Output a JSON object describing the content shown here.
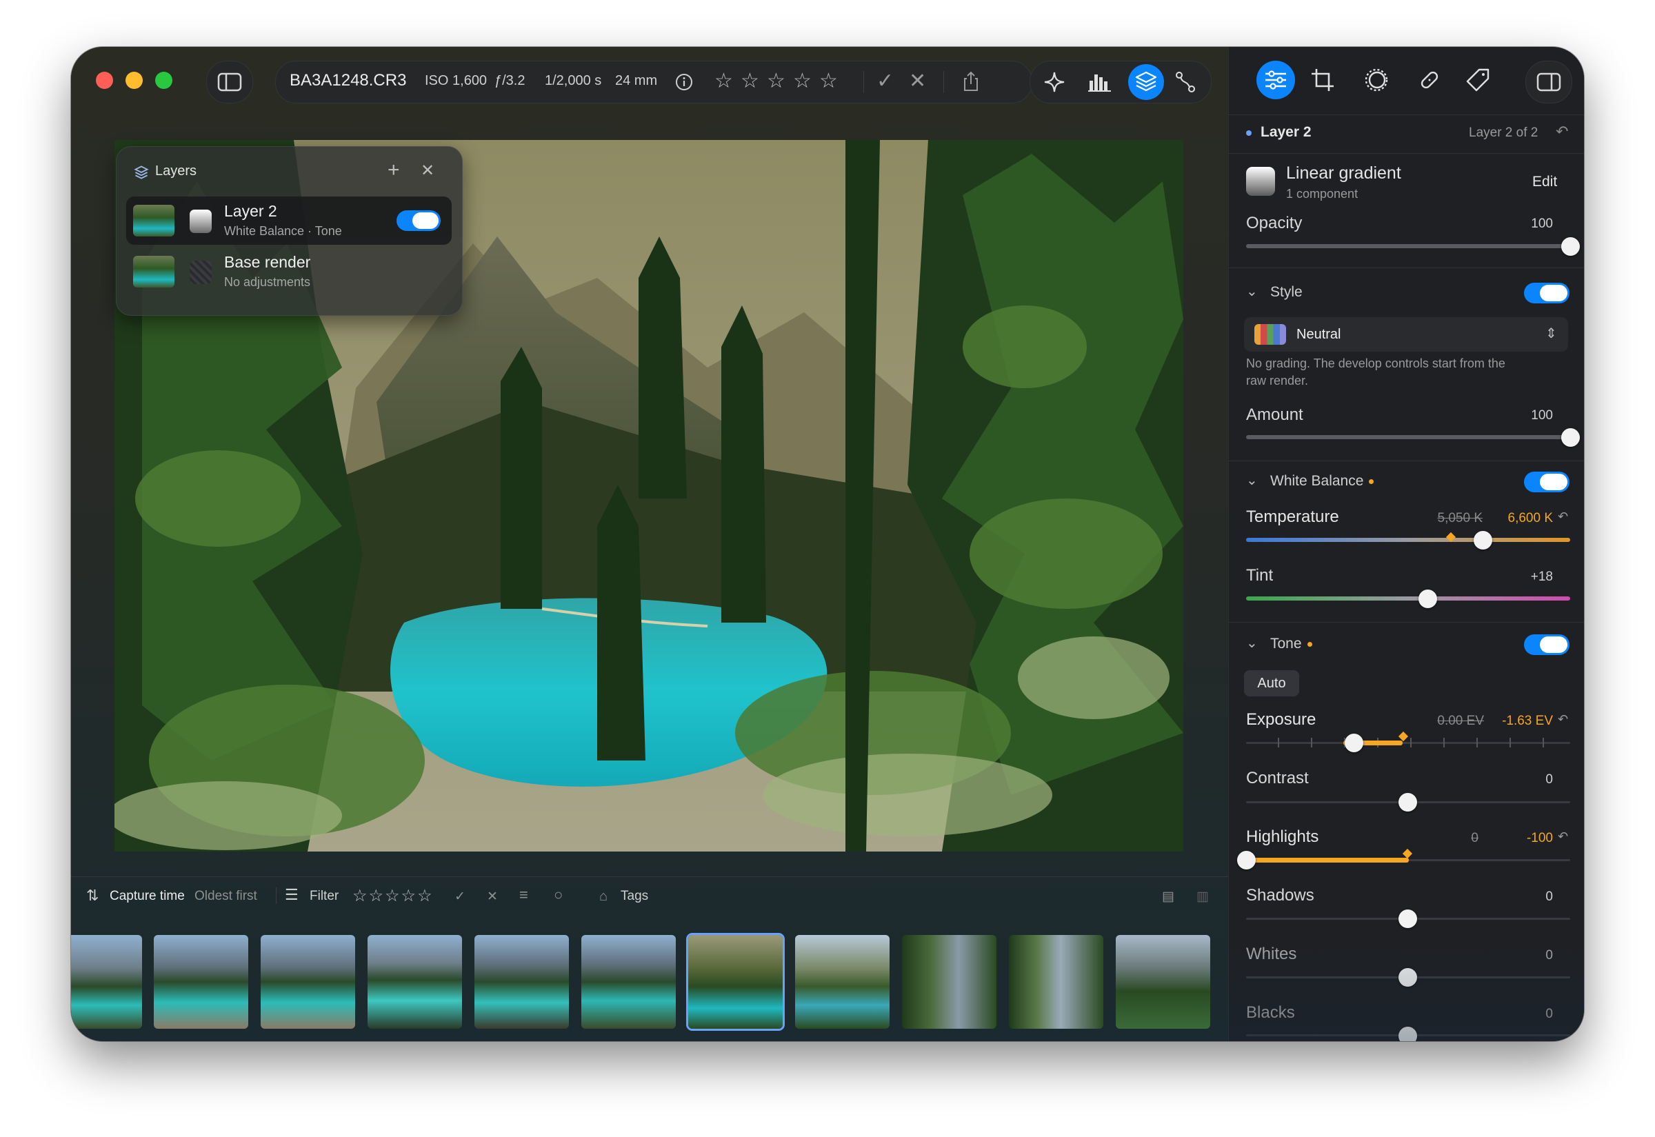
{
  "toolbar": {
    "filename": "BA3A1248.CR3",
    "iso": "ISO 1,600",
    "aperture": "ƒ/3.2",
    "shutter": "1/2,000 s",
    "focal": "24 mm",
    "rating_stars": 5
  },
  "layers_panel": {
    "title": "Layers",
    "layers": [
      {
        "name": "Layer 2",
        "subtitle": "White Balance · Tone",
        "enabled": true
      },
      {
        "name": "Base render",
        "subtitle": "No adjustments"
      }
    ]
  },
  "filter_bar": {
    "sort_label": "Capture time",
    "sort_order": "Oldest first",
    "filter_label": "Filter",
    "tags_label": "Tags"
  },
  "filmstrip": {
    "thumbnail_count": 11,
    "selected_index": 6
  },
  "right_panel": {
    "header": {
      "layer_title": "Layer 2",
      "layer_position": "Layer 2 of 2"
    },
    "mask": {
      "title": "Linear gradient",
      "subtitle": "1 component",
      "edit_label": "Edit"
    },
    "opacity": {
      "label": "Opacity",
      "value": "100",
      "level": 1.0
    },
    "style": {
      "section_label": "Style",
      "selected": "Neutral",
      "description_line1": "No grading. The develop controls start from the",
      "description_line2": "raw render.",
      "amount_label": "Amount",
      "amount_value": "100",
      "amount_level": 1.0
    },
    "white_balance": {
      "section_label": "White Balance",
      "temperature": {
        "label": "Temperature",
        "original": "5,050 K",
        "value": "6,600 K"
      },
      "tint": {
        "label": "Tint",
        "value": "+18"
      }
    },
    "tone": {
      "section_label": "Tone",
      "auto_label": "Auto",
      "exposure": {
        "label": "Exposure",
        "original": "0.00 EV",
        "value": "-1.63 EV"
      },
      "contrast": {
        "label": "Contrast",
        "value": "0"
      },
      "highlights": {
        "label": "Highlights",
        "original": "0",
        "value": "-100"
      },
      "shadows": {
        "label": "Shadows",
        "value": "0"
      },
      "whites": {
        "label": "Whites",
        "value": "0"
      },
      "blacks": {
        "label": "Blacks",
        "value": "0"
      }
    }
  },
  "colors": {
    "accent": "#0a84ff",
    "modified": "#f5a623",
    "close_red": "#ff5f57",
    "minimize_yellow": "#febc2e",
    "zoom_green": "#28c840"
  }
}
